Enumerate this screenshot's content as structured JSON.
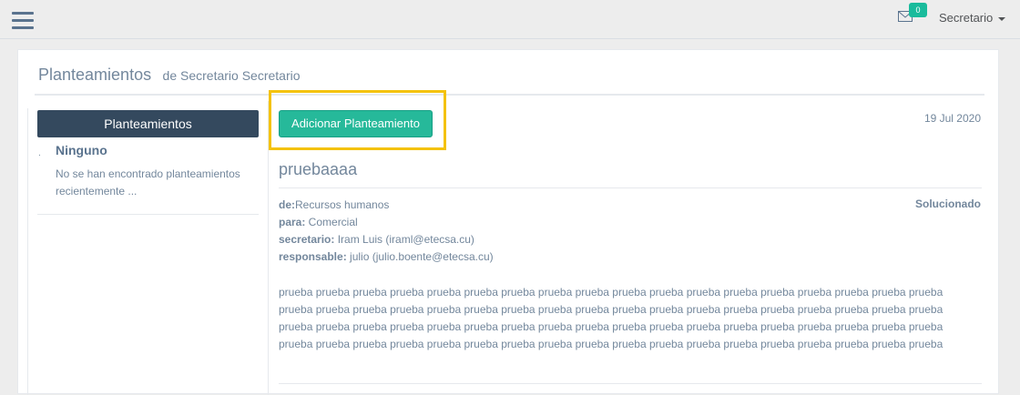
{
  "header": {
    "mail_count": "0",
    "user_label": "Secretario"
  },
  "page": {
    "title": "Planteamientos",
    "subtitle": "de Secretario Secretario"
  },
  "sidebar": {
    "heading": "Planteamientos",
    "item_name": "Ninguno",
    "item_description": "No se han encontrado planteamientos recientemente ..."
  },
  "toolbar": {
    "add_label": "Adicionar Planteamiento"
  },
  "message": {
    "date": "19 Jul 2020",
    "title": "pruebaaaa",
    "from_label": "de:",
    "from_value": "Recursos humanos",
    "to_label": "para:",
    "to_value": " Comercial",
    "secretary_label": "secretario:",
    "secretary_value": " Iram Luis (iraml@etecsa.cu)",
    "responsible_label": "responsable:",
    "responsible_value": " julio (julio.boente@etecsa.cu)",
    "status": "Solucionado",
    "body": "prueba prueba prueba prueba prueba prueba prueba prueba prueba prueba prueba prueba prueba prueba prueba prueba prueba prueba prueba prueba prueba prueba prueba prueba prueba prueba prueba prueba prueba prueba prueba prueba prueba prueba prueba prueba prueba prueba prueba prueba prueba prueba prueba prueba prueba prueba prueba prueba prueba prueba prueba prueba prueba prueba prueba prueba prueba prueba prueba prueba prueba prueba prueba prueba prueba prueba prueba prueba prueba prueba prueba prueba"
  },
  "colors": {
    "accent": "#1abb9c",
    "button": "#26b99a",
    "sidebar_head": "#34495e",
    "highlight": "#f4c20d"
  },
  "icons": [
    "menu-icon",
    "envelope-icon",
    "caret-down-icon"
  ]
}
